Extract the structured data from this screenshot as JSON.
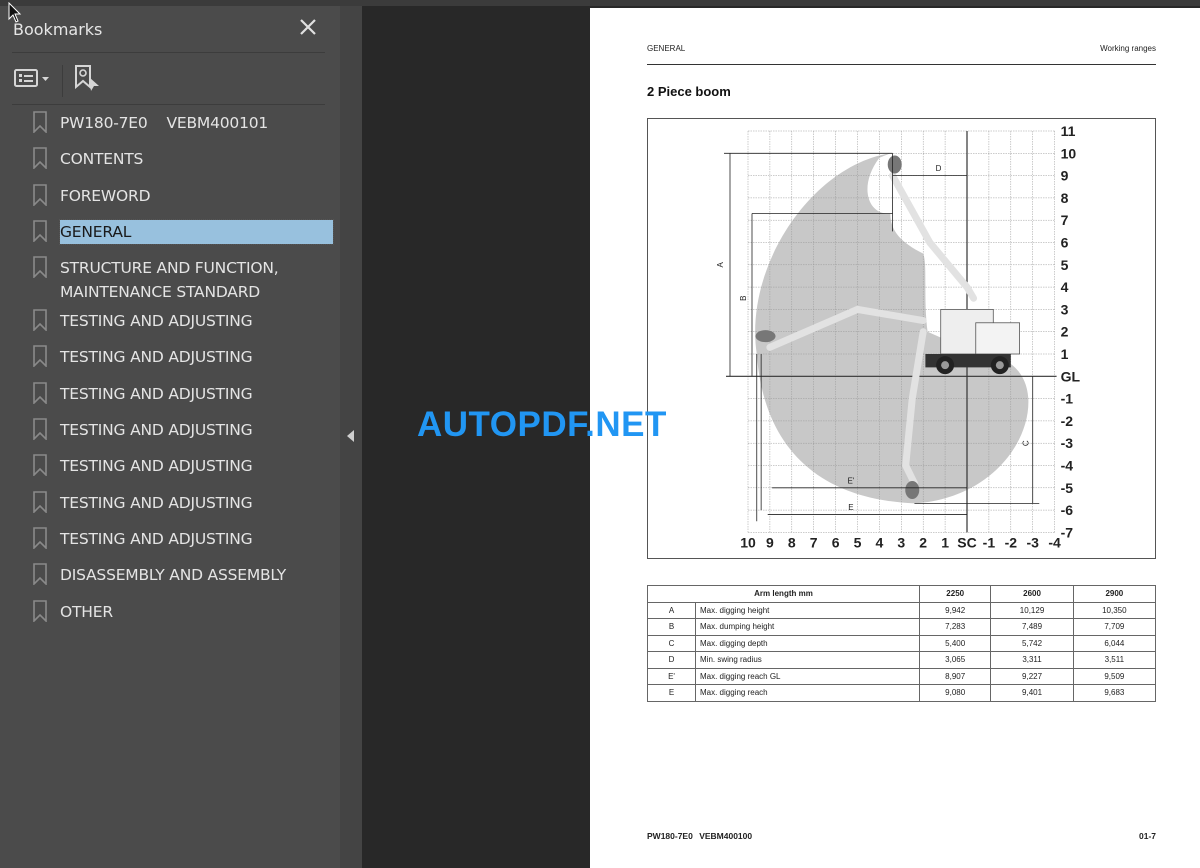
{
  "sidebar": {
    "title": "Bookmarks",
    "close_icon": "close-icon",
    "toolbar": {
      "options_icon": "list-options-icon",
      "find_icon": "find-current-bookmark-icon"
    },
    "items": [
      {
        "label": "PW180-7E0    VEBM400101",
        "selected": false
      },
      {
        "label": "CONTENTS",
        "selected": false
      },
      {
        "label": "FOREWORD",
        "selected": false
      },
      {
        "label": "GENERAL",
        "selected": true
      },
      {
        "label": "STRUCTURE AND FUNCTION, MAINTENANCE STANDARD",
        "selected": false
      },
      {
        "label": "TESTING AND ADJUSTING",
        "selected": false
      },
      {
        "label": "TESTING AND ADJUSTING",
        "selected": false
      },
      {
        "label": "TESTING AND ADJUSTING",
        "selected": false
      },
      {
        "label": "TESTING AND ADJUSTING",
        "selected": false
      },
      {
        "label": "TESTING AND ADJUSTING",
        "selected": false
      },
      {
        "label": "TESTING AND ADJUSTING",
        "selected": false
      },
      {
        "label": "TESTING AND ADJUSTING",
        "selected": false
      },
      {
        "label": "DISASSEMBLY AND ASSEMBLY",
        "selected": false
      },
      {
        "label": "OTHER",
        "selected": false
      }
    ]
  },
  "collapse_icon": "collapse-panel-arrow-icon",
  "watermark": "AUTOPDF.NET",
  "page": {
    "header_left": "GENERAL",
    "header_right": "Working ranges",
    "title": "2 Piece boom",
    "figure": {
      "x_ticks": [
        "10",
        "9",
        "8",
        "7",
        "6",
        "5",
        "4",
        "3",
        "2",
        "1",
        "SC",
        "-1",
        "-2",
        "-3",
        "-4"
      ],
      "y_ticks": [
        "11",
        "10",
        "9",
        "8",
        "7",
        "6",
        "5",
        "4",
        "3",
        "2",
        "1",
        "GL",
        "-1",
        "-2",
        "-3",
        "-4",
        "-5",
        "-6",
        "-7"
      ],
      "dimension_labels": {
        "A": "A",
        "B": "B",
        "C": "C",
        "D": "D",
        "E_prime": "E'",
        "E": "E"
      }
    },
    "table": {
      "header": {
        "label": "Arm length mm",
        "cols": [
          "2250",
          "2600",
          "2900"
        ]
      },
      "rows": [
        {
          "code": "A",
          "desc": "Max. digging height",
          "values": [
            "9,942",
            "10,129",
            "10,350"
          ]
        },
        {
          "code": "B",
          "desc": "Max. dumping height",
          "values": [
            "7,283",
            "7,489",
            "7,709"
          ]
        },
        {
          "code": "C",
          "desc": "Max. digging depth",
          "values": [
            "5,400",
            "5,742",
            "6,044"
          ]
        },
        {
          "code": "D",
          "desc": "Min. swing radius",
          "values": [
            "3,065",
            "3,311",
            "3,511"
          ]
        },
        {
          "code": "E'",
          "desc": "Max. digging reach GL",
          "values": [
            "8,907",
            "9,227",
            "9,509"
          ]
        },
        {
          "code": "E",
          "desc": "Max. digging reach",
          "values": [
            "9,080",
            "9,401",
            "9,683"
          ]
        }
      ]
    },
    "footer_left": "PW180-7E0   VEBM400100",
    "footer_right": "01-7"
  }
}
